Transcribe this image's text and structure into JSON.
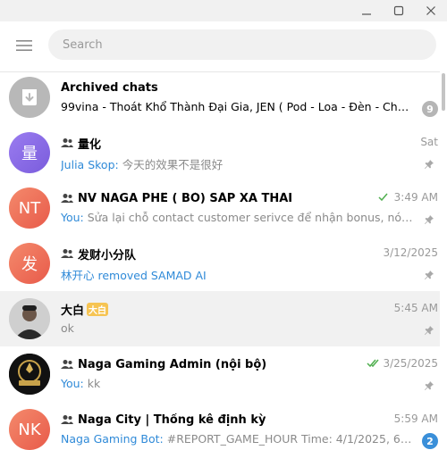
{
  "window": {
    "controls": [
      "minimize",
      "maximize",
      "close"
    ]
  },
  "header": {
    "search_placeholder": "Search"
  },
  "colors": {
    "accent": "#2f8ad8",
    "avatar_purple": "#8f6fe8",
    "avatar_red": "#ef6a5a",
    "check_green": "#4fae4e",
    "unread_grey": "#b5b5b5",
    "unread_blue": "#3a8fd9"
  },
  "chats": [
    {
      "name": "Archived chats",
      "preview": "99vina - Thoát Khổ Thành Đại Gia, JEN ( Pod - Loa - Đèn - Chuyể…",
      "unread": "9",
      "avatar_icon": "archive-icon"
    },
    {
      "name": "量化",
      "avatar_text": "量",
      "time": "Sat",
      "sender": "Julia Skop:",
      "preview": " 今天的效果不是很好",
      "group": true,
      "pinned": true
    },
    {
      "name": "NV NAGA PHẾ ( BỎ) SẮP XA THẢI",
      "avatar_text": "NT",
      "time": "3:49 AM",
      "status_icon": "double-check-icon",
      "sender": "You:",
      "preview": " Sửa lại chỗ contact customer serivce để nhận bonus, nó aut…",
      "group": true,
      "pinned": true
    },
    {
      "name": "发财小分队",
      "avatar_text": "发",
      "time": "3/12/2025",
      "preview_service": "林开心 removed SAMAD AI",
      "group": true,
      "pinned": true
    },
    {
      "name": "大白",
      "name_badge": "大白",
      "time": "5:45 AM",
      "preview": "ok",
      "pinned": true,
      "avatar_icon": "person-photo"
    },
    {
      "name": "Naga Gaming Admin (nội bộ)",
      "time": "3/25/2025",
      "status_icon": "double-check-icon",
      "sender": "You:",
      "preview": " kk",
      "group": true,
      "pinned": true,
      "avatar_icon": "naga-logo"
    },
    {
      "name": "Naga City | Thống kê định kỳ",
      "avatar_text": "NK",
      "time": "5:59 AM",
      "sender": "Naga Gaming Bot:",
      "preview": " #REPORT_GAME_HOUR Time: 4/1/2025, 6:00:00…",
      "unread": "2",
      "group": true
    }
  ]
}
